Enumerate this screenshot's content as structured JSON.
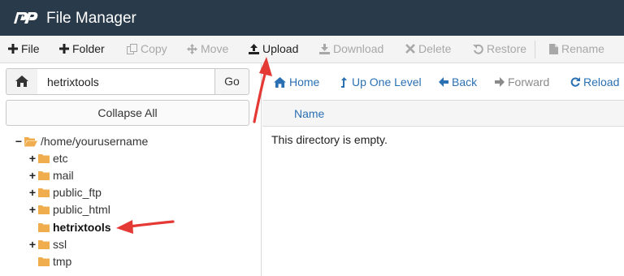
{
  "app": {
    "title": "File Manager"
  },
  "toolbar": {
    "items": [
      {
        "label": "File",
        "icon": "plus-icon",
        "enabled": true
      },
      {
        "label": "Folder",
        "icon": "plus-icon",
        "enabled": true
      },
      {
        "label": "Copy",
        "icon": "copy-icon",
        "enabled": false
      },
      {
        "label": "Move",
        "icon": "move-icon",
        "enabled": false
      },
      {
        "label": "Upload",
        "icon": "upload-icon",
        "enabled": true
      },
      {
        "label": "Download",
        "icon": "download-icon",
        "enabled": false
      },
      {
        "label": "Delete",
        "icon": "close-icon",
        "enabled": false
      },
      {
        "label": "Restore",
        "icon": "restore-icon",
        "enabled": false
      },
      {
        "label": "Rename",
        "icon": "file-icon",
        "enabled": false
      }
    ]
  },
  "path_bar": {
    "value": "hetrixtools",
    "go_label": "Go"
  },
  "collapse_label": "Collapse All",
  "tree": {
    "root": "/home/yourusername",
    "items": [
      {
        "label": "etc",
        "expandable": true
      },
      {
        "label": "mail",
        "expandable": true
      },
      {
        "label": "public_ftp",
        "expandable": true
      },
      {
        "label": "public_html",
        "expandable": true
      },
      {
        "label": "hetrixtools",
        "expandable": false,
        "selected": true
      },
      {
        "label": "ssl",
        "expandable": true
      },
      {
        "label": "tmp",
        "expandable": false
      }
    ]
  },
  "nav": {
    "home": "Home",
    "up": "Up One Level",
    "back": "Back",
    "forward": "Forward",
    "reload": "Reload"
  },
  "list": {
    "column_name": "Name",
    "empty_message": "This directory is empty."
  },
  "colors": {
    "header_bg": "#293a4a",
    "link": "#2a70b3",
    "folder": "#f0ad4e",
    "arrow": "#e53935"
  }
}
